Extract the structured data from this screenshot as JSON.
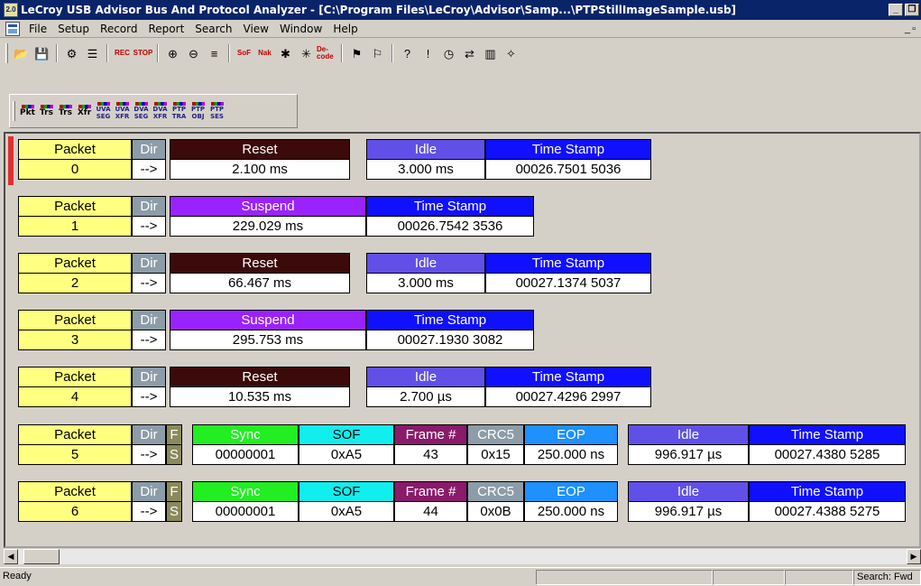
{
  "window": {
    "title": "LeCroy USB Advisor Bus And Protocol Analyzer - [C:\\Program Files\\LeCroy\\Advisor\\Samp...\\PTPStillImageSample.usb]",
    "app_icon": "2.0"
  },
  "menu": [
    "File",
    "Setup",
    "Record",
    "Report",
    "Search",
    "View",
    "Window",
    "Help"
  ],
  "toolbar_main": [
    {
      "name": "open-icon",
      "glyph": "📂"
    },
    {
      "name": "save-icon",
      "glyph": "💾"
    },
    {
      "name": "trigger-icon",
      "glyph": "⚙"
    },
    {
      "name": "filter-icon",
      "glyph": "☰"
    },
    {
      "name": "record-icon",
      "glyph": "REC"
    },
    {
      "name": "stop-icon",
      "glyph": "STOP"
    },
    {
      "name": "zoom-in-icon",
      "glyph": "⊕"
    },
    {
      "name": "zoom-out-icon",
      "glyph": "⊖"
    },
    {
      "name": "wrap-icon",
      "glyph": "≡"
    },
    {
      "name": "hide-sof-icon",
      "glyph": "SoF"
    },
    {
      "name": "hide-nak-icon",
      "glyph": "Nak"
    },
    {
      "name": "hide-chirp-icon",
      "glyph": "✱"
    },
    {
      "name": "hide-noise-icon",
      "glyph": "✳"
    },
    {
      "name": "decode-icon",
      "glyph": "De-code"
    },
    {
      "name": "marker-icon",
      "glyph": "⚑"
    },
    {
      "name": "clear-marker-icon",
      "glyph": "⚐"
    },
    {
      "name": "help-icon",
      "glyph": "?"
    },
    {
      "name": "error-icon",
      "glyph": "!"
    },
    {
      "name": "timing-icon",
      "glyph": "◷"
    },
    {
      "name": "bandwidth-icon",
      "glyph": "⇄"
    },
    {
      "name": "statistics-icon",
      "glyph": "▥"
    },
    {
      "name": "bus-utilization-icon",
      "glyph": "✧"
    }
  ],
  "toolbar_views": [
    "Pkt",
    "Trs",
    "Trs",
    "Xfr",
    "UVA SEG",
    "UVA XFR",
    "DVA SEG",
    "DVA XFR",
    "PTP TRA",
    "PTP OBJ",
    "PTP SES"
  ],
  "records": [
    {
      "packet_label": "Packet",
      "packet": "0",
      "dir_label": "Dir",
      "dir": "-->",
      "fields": [
        {
          "label": "Reset",
          "value": "2.100 ms",
          "color": "#3c0a0a"
        },
        {
          "label": "Idle",
          "value": "3.000 ms",
          "color": "#6050e8"
        },
        {
          "label": "Time Stamp",
          "value": "00026.7501 5036",
          "color": "#1010ff"
        }
      ]
    },
    {
      "packet_label": "Packet",
      "packet": "1",
      "dir_label": "Dir",
      "dir": "-->",
      "fields": [
        {
          "label": "Suspend",
          "value": "229.029 ms",
          "color": "#9a22ff"
        },
        {
          "label": "Time Stamp",
          "value": "00026.7542 3536",
          "color": "#1010ff"
        }
      ]
    },
    {
      "packet_label": "Packet",
      "packet": "2",
      "dir_label": "Dir",
      "dir": "-->",
      "fields": [
        {
          "label": "Reset",
          "value": "66.467 ms",
          "color": "#3c0a0a"
        },
        {
          "label": "Idle",
          "value": "3.000 ms",
          "color": "#6050e8"
        },
        {
          "label": "Time Stamp",
          "value": "00027.1374 5037",
          "color": "#1010ff"
        }
      ]
    },
    {
      "packet_label": "Packet",
      "packet": "3",
      "dir_label": "Dir",
      "dir": "-->",
      "fields": [
        {
          "label": "Suspend",
          "value": "295.753 ms",
          "color": "#9a22ff"
        },
        {
          "label": "Time Stamp",
          "value": "00027.1930 3082",
          "color": "#1010ff"
        }
      ]
    },
    {
      "packet_label": "Packet",
      "packet": "4",
      "dir_label": "Dir",
      "dir": "-->",
      "fields": [
        {
          "label": "Reset",
          "value": "10.535 ms",
          "color": "#3c0a0a"
        },
        {
          "label": "Idle",
          "value": "2.700 µs",
          "color": "#6050e8"
        },
        {
          "label": "Time Stamp",
          "value": "00027.4296 2997",
          "color": "#1010ff"
        }
      ]
    },
    {
      "packet_label": "Packet",
      "packet": "5",
      "dir_label": "Dir",
      "dir": "-->",
      "fs_top": "F",
      "fs_bottom": "S",
      "fields": [
        {
          "label": "Sync",
          "value": "00000001"
        },
        {
          "label": "SOF",
          "value": "0xA5"
        },
        {
          "label": "Frame #",
          "value": "43"
        },
        {
          "label": "CRC5",
          "value": "0x15"
        },
        {
          "label": "EOP",
          "value": "250.000 ns"
        },
        {
          "label": "Idle",
          "value": "996.917 µs"
        },
        {
          "label": "Time Stamp",
          "value": "00027.4380 5285"
        }
      ]
    },
    {
      "packet_label": "Packet",
      "packet": "6",
      "dir_label": "Dir",
      "dir": "-->",
      "fs_top": "F",
      "fs_bottom": "S",
      "fields": [
        {
          "label": "Sync",
          "value": "00000001"
        },
        {
          "label": "SOF",
          "value": "0xA5"
        },
        {
          "label": "Frame #",
          "value": "44"
        },
        {
          "label": "CRC5",
          "value": "0x0B"
        },
        {
          "label": "EOP",
          "value": "250.000 ns"
        },
        {
          "label": "Idle",
          "value": "996.917 µs"
        },
        {
          "label": "Time Stamp",
          "value": "00027.4388 5275"
        }
      ]
    }
  ],
  "status": {
    "ready": "Ready",
    "search": "Search: Fwd"
  },
  "colors": {
    "packet": "#ffff80",
    "dir": "#8c9ca8",
    "sync": "#22ee22",
    "sof": "#11eeee",
    "frame": "#8a1a6a",
    "crc": "#8c9ca8",
    "eop": "#1e90ff",
    "fs": "#8a8a5a",
    "error_marker": "#e03030"
  }
}
